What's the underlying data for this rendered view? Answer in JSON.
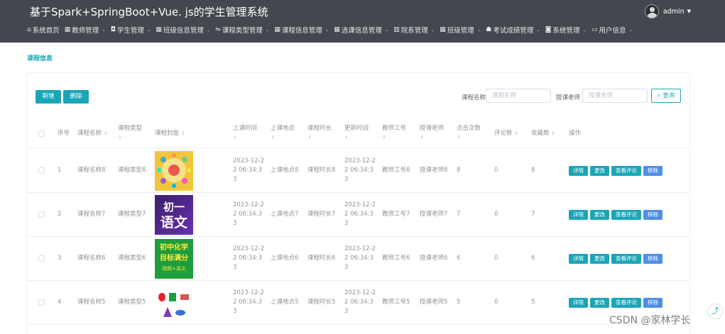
{
  "header": {
    "title": "基于Spark+SpringBoot+Vue. js的学生管理系统",
    "user": "admin",
    "nav": [
      {
        "icon": "⌂",
        "label": "系统首页",
        "chev": ""
      },
      {
        "icon": "▦",
        "label": "教师管理",
        "chev": "⌄"
      },
      {
        "icon": "◘",
        "label": "学生管理",
        "chev": "⌄"
      },
      {
        "icon": "▦",
        "label": "班级信息管理",
        "chev": "⌄"
      },
      {
        "icon": "⇋",
        "label": "课程类型管理",
        "chev": "⌄"
      },
      {
        "icon": "▦",
        "label": "课程信息管理",
        "chev": "⌄"
      },
      {
        "icon": "▦",
        "label": "选课信息管理",
        "chev": "⌄"
      },
      {
        "icon": "▥",
        "label": "院系管理",
        "chev": "⌄"
      },
      {
        "icon": "▦",
        "label": "班级管理",
        "chev": "⌄"
      },
      {
        "icon": "☗",
        "label": "考试成绩管理",
        "chev": "⌄"
      },
      {
        "icon": "◙",
        "label": "系统管理",
        "chev": "⌄"
      },
      {
        "icon": "▭",
        "label": "用户信息",
        "chev": "⌄"
      }
    ]
  },
  "breadcrumb": "课程信息",
  "toolbar": {
    "add_label": "新增",
    "delete_label": "删除",
    "course_name_label": "课程名称",
    "course_name_placeholder": "课程名称",
    "teacher_label": "授课老师",
    "teacher_placeholder": "授课老师",
    "search_label": "查询"
  },
  "sort_glyph": "⇕",
  "table": {
    "headers": {
      "index": "序号",
      "name": "课程名称",
      "type": "课程类型",
      "cover": "课程封面",
      "time": "上课时间",
      "place": "上课地点",
      "duration": "课程时长",
      "updated": "更新时间",
      "teacher_no": "教师工号",
      "teacher": "授课老师",
      "clicks": "点击次数",
      "comments": "评论数",
      "favorites": "收藏数",
      "actions": "操作"
    },
    "actions": {
      "detail": "详情",
      "edit": "更改",
      "view_comments": "查看评论",
      "remove": "移除"
    },
    "rows": [
      {
        "index": "1",
        "name": "课程名称8",
        "type": "课程类型8",
        "time": "2023-12-22 06:34:33",
        "place": "上课地点8",
        "duration": "课程时长8",
        "updated": "2023-12-22 06:34:33",
        "teacher_no": "教师工号8",
        "teacher": "授课老师8",
        "clicks": "8",
        "comments": "0",
        "favorites": "8",
        "cover": "colorful-wheel"
      },
      {
        "index": "2",
        "name": "课程名称7",
        "type": "课程类型7",
        "time": "2023-12-22 06:34:33",
        "place": "上课地点7",
        "duration": "课程时长7",
        "updated": "2023-12-22 06:34:33",
        "teacher_no": "教师工号7",
        "teacher": "授课老师7",
        "clicks": "7",
        "comments": "0",
        "favorites": "7",
        "cover": "chinese",
        "cover_text": [
          "初一",
          "语文"
        ]
      },
      {
        "index": "3",
        "name": "课程名称6",
        "type": "课程类型6",
        "time": "2023-12-22 06:34:33",
        "place": "上课地点6",
        "duration": "课程时长6",
        "updated": "2023-12-22 06:34:33",
        "teacher_no": "教师工号6",
        "teacher": "授课老师6",
        "clicks": "6",
        "comments": "0",
        "favorites": "6",
        "cover": "chemistry",
        "cover_text": [
          "初中化学",
          "目标满分",
          "视频+讲义"
        ]
      },
      {
        "index": "4",
        "name": "课程名称5",
        "type": "课程类型5",
        "time": "2023-12-22 06:34:33",
        "place": "上课地点5",
        "duration": "课程时长5",
        "updated": "2023-12-22 06:34:33",
        "teacher_no": "教师工号5",
        "teacher": "授课老师5",
        "clicks": "5",
        "comments": "0",
        "favorites": "5",
        "cover": "shapes"
      }
    ]
  },
  "colors": {
    "accent": "#1aa6b7",
    "header_bg": "#43474e",
    "remove": "#4f8ee8"
  },
  "watermark": "CSDN @家林学长"
}
